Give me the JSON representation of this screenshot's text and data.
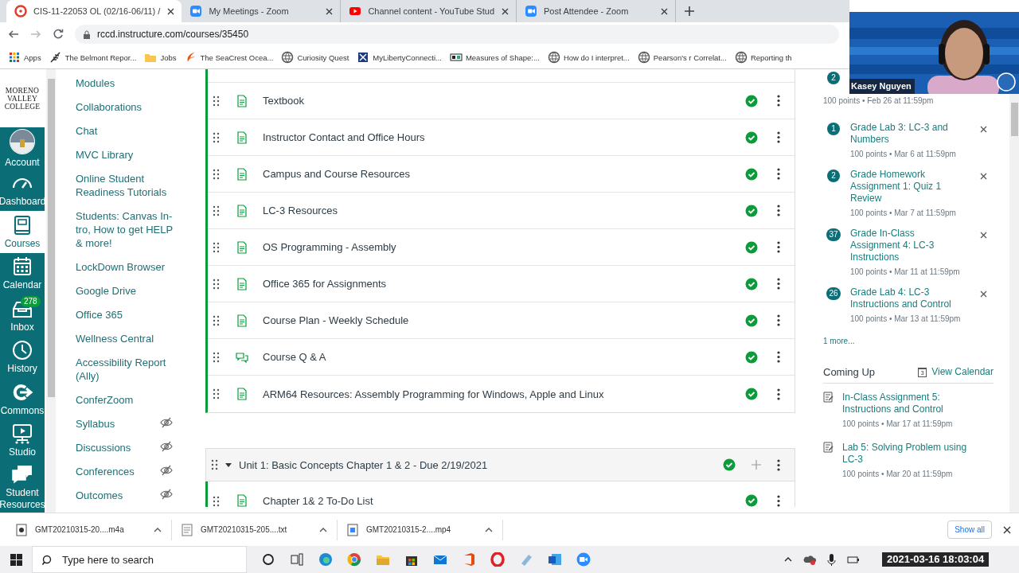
{
  "browser": {
    "tabs": [
      {
        "title": "CIS-11-22053 OL (02/16-06/11) /",
        "kind": "canvas",
        "selected": true
      },
      {
        "title": "My Meetings - Zoom",
        "kind": "zoom",
        "selected": false
      },
      {
        "title": "Channel content - YouTube Stud",
        "kind": "youtube",
        "selected": false
      },
      {
        "title": "Post Attendee - Zoom",
        "kind": "zoom",
        "selected": false
      }
    ],
    "url": "rccd.instructure.com/courses/35450",
    "bookmarks": [
      {
        "label": "Apps",
        "kind": "apps"
      },
      {
        "label": "The Belmont Repor...",
        "kind": "feather"
      },
      {
        "label": "Jobs",
        "kind": "folder"
      },
      {
        "label": "The SeaCrest Ocea...",
        "kind": "flame"
      },
      {
        "label": "Curiosity Quest",
        "kind": "globe"
      },
      {
        "label": "MyLibertyConnecti...",
        "kind": "crest"
      },
      {
        "label": "Measures of Shape:...",
        "kind": "tag"
      },
      {
        "label": "How do I interpret...",
        "kind": "globe"
      },
      {
        "label": "Pearson's r Correlat...",
        "kind": "globe"
      },
      {
        "label": "Reporting th",
        "kind": "globe"
      }
    ]
  },
  "global_nav": {
    "logo": [
      "MORENO",
      "VALLEY",
      "COLLEGE"
    ],
    "items": [
      {
        "label": "Account",
        "kind": "avatar",
        "selected": false
      },
      {
        "label": "Dashboard",
        "kind": "gauge",
        "selected": false
      },
      {
        "label": "Courses",
        "kind": "book",
        "selected": true
      },
      {
        "label": "Calendar",
        "kind": "calendar",
        "selected": false
      },
      {
        "label": "Inbox",
        "kind": "inbox",
        "selected": false,
        "badge": "278"
      },
      {
        "label": "History",
        "kind": "clock",
        "selected": false
      },
      {
        "label": "Commons",
        "kind": "share",
        "selected": false
      },
      {
        "label": "Studio",
        "kind": "studio",
        "selected": false
      },
      {
        "label": "Student Resources",
        "kind": "chat",
        "selected": false
      }
    ]
  },
  "course_nav": [
    {
      "label": "Modules",
      "hidden": false
    },
    {
      "label": "Collaborations",
      "hidden": false
    },
    {
      "label": "Chat",
      "hidden": false
    },
    {
      "label": "MVC Library",
      "hidden": false
    },
    {
      "label": "Online Student Readiness Tutorials",
      "hidden": false
    },
    {
      "label": "Students: Canvas In-tro, How to get HELP & more!",
      "hidden": false
    },
    {
      "label": "LockDown Browser",
      "hidden": false
    },
    {
      "label": "Google Drive",
      "hidden": false
    },
    {
      "label": "Office 365",
      "hidden": false
    },
    {
      "label": "Wellness Central",
      "hidden": false
    },
    {
      "label": "Accessibility Report (Ally)",
      "hidden": false
    },
    {
      "label": "ConferZoom",
      "hidden": false
    },
    {
      "label": "Syllabus",
      "hidden": true
    },
    {
      "label": "Discussions",
      "hidden": true
    },
    {
      "label": "Conferences",
      "hidden": true
    },
    {
      "label": "Outcomes",
      "hidden": true
    }
  ],
  "modules": {
    "items": [
      {
        "title": "Textbook",
        "kind": "page",
        "published": true
      },
      {
        "title": "Instructor Contact and Office Hours",
        "kind": "page",
        "published": true
      },
      {
        "title": "Campus and Course Resources",
        "kind": "page",
        "published": true
      },
      {
        "title": "LC-3 Resources",
        "kind": "page",
        "published": true
      },
      {
        "title": "OS Programming - Assembly",
        "kind": "page",
        "published": true
      },
      {
        "title": "Office 365 for Assignments",
        "kind": "page",
        "published": true
      },
      {
        "title": "Course Plan - Weekly Schedule",
        "kind": "page",
        "published": true
      },
      {
        "title": "Course Q & A",
        "kind": "discussion",
        "published": true
      },
      {
        "title": "ARM64 Resources: Assembly Programming for Windows, Apple and Linux",
        "kind": "page",
        "published": true
      }
    ],
    "unit": {
      "title": "Unit 1: Basic Concepts Chapter 1 & 2 - Due 2/19/2021",
      "expanded": true,
      "published": true,
      "items": [
        {
          "title": "Chapter 1& 2 To-Do List",
          "kind": "page",
          "published": true
        }
      ]
    }
  },
  "todo": {
    "items": [
      {
        "badge": "2",
        "meta": "100 points • Feb 26 at 11:59pm"
      },
      {
        "badge": "1",
        "title": "Grade Lab 3: LC-3 and Numbers",
        "meta": "100 points • Mar 6 at 11:59pm"
      },
      {
        "badge": "2",
        "title": "Grade Homework Assignment 1: Quiz 1 Review",
        "meta": "100 points • Mar 7 at 11:59pm"
      },
      {
        "badge": "37",
        "title": "Grade In-Class Assignment 4: LC-3 Instructions",
        "meta": "100 points • Mar 11 at 11:59pm"
      },
      {
        "badge": "26",
        "title": "Grade Lab 4: LC-3 Instructions and Control",
        "meta": "100 points • Mar 13 at 11:59pm"
      }
    ],
    "more": "1 more..."
  },
  "coming_up": {
    "title": "Coming Up",
    "view_calendar": "View Calendar",
    "calendar_day": "3",
    "items": [
      {
        "title": "In-Class Assignment 5: Instructions and Control",
        "meta": "100 points • Mar 17 at 11:59pm"
      },
      {
        "title": "Lab 5: Solving Problem using LC-3",
        "meta": "100 points • Mar 20 at 11:59pm"
      }
    ]
  },
  "downloads": {
    "files": [
      {
        "name": "GMT20210315-20....m4a",
        "kind": "audio"
      },
      {
        "name": "GMT20210315-205....txt",
        "kind": "text"
      },
      {
        "name": "GMT20210315-2....mp4",
        "kind": "video"
      }
    ],
    "show_all": "Show all"
  },
  "taskbar": {
    "search_placeholder": "Type here to search"
  },
  "video": {
    "name": "Kasey Nguyen",
    "kind": "picture"
  },
  "recording_timestamp": "2021-03-16 18:03:04"
}
